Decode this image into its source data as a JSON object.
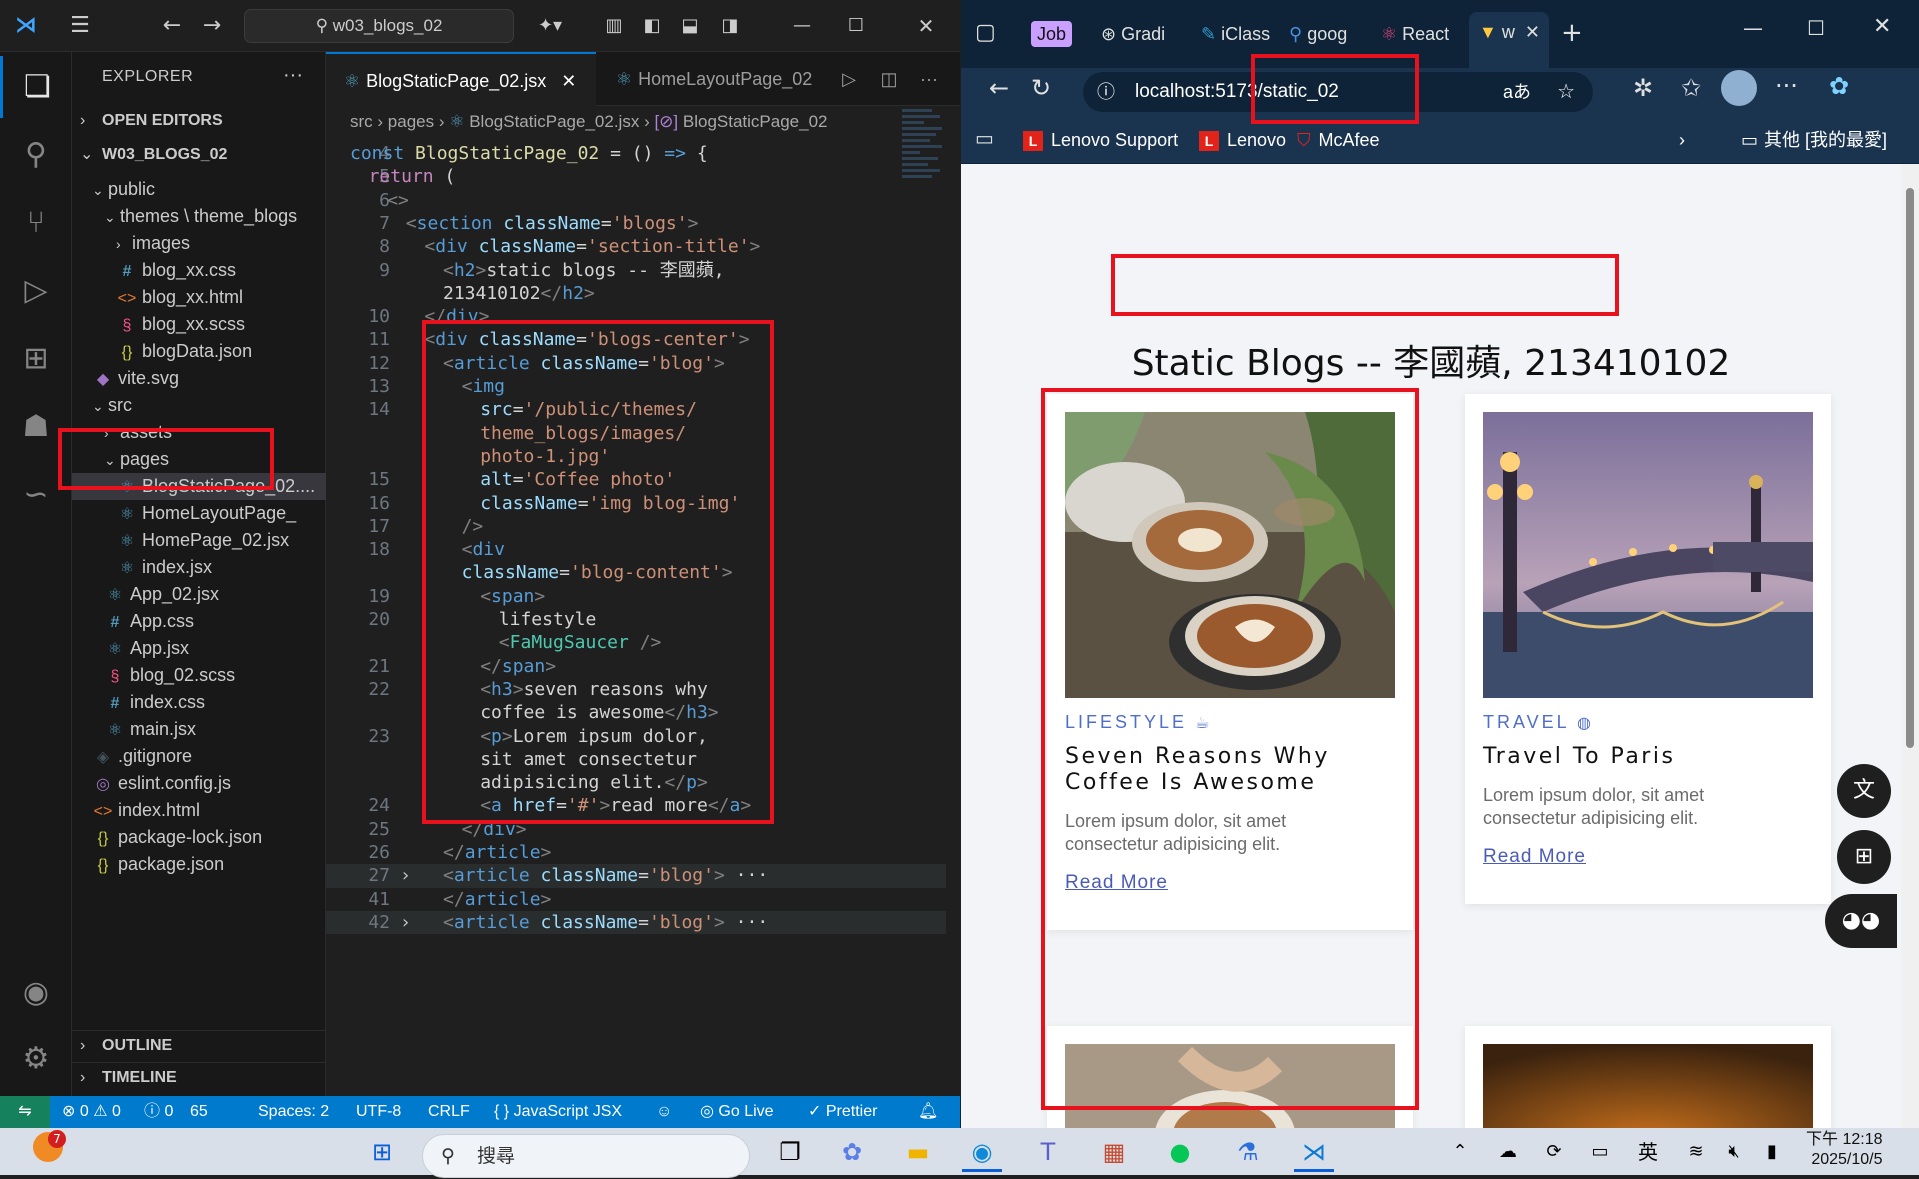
{
  "vscode": {
    "search": "w03_blogs_02",
    "explorer_title": "EXPLORER",
    "sections": {
      "open_editors": "OPEN EDITORS",
      "project": "W03_BLOGS_02",
      "outline": "OUTLINE",
      "timeline": "TIMELINE"
    },
    "tree": [
      {
        "label": "public",
        "icon": "chevron",
        "type": "folder"
      },
      {
        "label": "themes \\ theme_blogs",
        "icon": "chevron",
        "type": "folder"
      },
      {
        "label": "images",
        "icon": "chevron-right",
        "type": "folder"
      },
      {
        "label": "blog_xx.css",
        "icon": "#",
        "type": "css"
      },
      {
        "label": "blog_xx.html",
        "icon": "<>",
        "type": "html"
      },
      {
        "label": "blog_xx.scss",
        "icon": "scss",
        "type": "scss"
      },
      {
        "label": "blogData.json",
        "icon": "{}",
        "type": "json"
      },
      {
        "label": "vite.svg",
        "icon": "svg",
        "type": "svg"
      },
      {
        "label": "src",
        "icon": "chevron",
        "type": "folder"
      },
      {
        "label": "assets",
        "icon": "chevron-right",
        "type": "folder"
      },
      {
        "label": "pages",
        "icon": "chevron",
        "type": "folder"
      },
      {
        "label": "BlogStaticPage_02....",
        "icon": "react",
        "type": "react"
      },
      {
        "label": "HomeLayoutPage_",
        "icon": "react",
        "type": "react"
      },
      {
        "label": "HomePage_02.jsx",
        "icon": "react",
        "type": "react"
      },
      {
        "label": "index.jsx",
        "icon": "react",
        "type": "react"
      },
      {
        "label": "App_02.jsx",
        "icon": "react",
        "type": "react"
      },
      {
        "label": "App.css",
        "icon": "#",
        "type": "css"
      },
      {
        "label": "App.jsx",
        "icon": "react",
        "type": "react"
      },
      {
        "label": "blog_02.scss",
        "icon": "scss",
        "type": "scss"
      },
      {
        "label": "index.css",
        "icon": "#",
        "type": "css"
      },
      {
        "label": "main.jsx",
        "icon": "react",
        "type": "react"
      },
      {
        "label": ".gitignore",
        "icon": "git",
        "type": "git"
      },
      {
        "label": "eslint.config.js",
        "icon": "eslint",
        "type": "eslint"
      },
      {
        "label": "index.html",
        "icon": "<>",
        "type": "html"
      },
      {
        "label": "package-lock.json",
        "icon": "{}",
        "type": "json"
      },
      {
        "label": "package.json",
        "icon": "{}",
        "type": "json"
      }
    ],
    "tabs": [
      {
        "label": "BlogStaticPage_02.jsx",
        "active": true
      },
      {
        "label": "HomeLayoutPage_02",
        "active": false
      }
    ],
    "breadcrumb": [
      "src",
      "pages",
      "BlogStaticPage_02.jsx",
      "BlogStaticPage_02"
    ],
    "code_lines": [
      {
        "n": "4",
        "html": "<span class='kw'>const</span> <span class='fn'>BlogStaticPage_02</span> <span class='txt'>= () </span><span class='kw'>=&gt;</span><span class='txt'> {</span>",
        "indent": 0
      },
      {
        "n": "5",
        "html": "<span class='ctl'>return</span> <span class='txt'>(</span>",
        "indent": 1
      },
      {
        "n": "6",
        "html": "<span class='pu'>&lt;&gt;</span>",
        "indent": 2
      },
      {
        "n": "7",
        "html": "<span class='pu'>&lt;</span><span class='tg'>section</span> <span class='at'>className</span><span class='txt'>=</span><span class='st'>'blogs'</span><span class='pu'>&gt;</span>",
        "indent": 3
      },
      {
        "n": "8",
        "html": "<span class='pu'>&lt;</span><span class='tg'>div</span> <span class='at'>className</span><span class='txt'>=</span><span class='st'>'section-title'</span><span class='pu'>&gt;</span>",
        "indent": 4
      },
      {
        "n": "9",
        "html": "<span class='pu'>&lt;</span><span class='tg'>h2</span><span class='pu'>&gt;</span><span class='txt'>static blogs -- 李國蘋,</span>",
        "indent": 5
      },
      {
        "n": "",
        "html": "<span class='txt'>213410102</span><span class='pu'>&lt;/</span><span class='tg'>h2</span><span class='pu'>&gt;</span>",
        "indent": 5
      },
      {
        "n": "10",
        "html": "<span class='pu'>&lt;/</span><span class='tg'>div</span><span class='pu'>&gt;</span>",
        "indent": 4
      },
      {
        "n": "11",
        "html": "<span class='pu'>&lt;</span><span class='tg'>div</span> <span class='at'>className</span><span class='txt'>=</span><span class='st'>'blogs-center'</span><span class='pu'>&gt;</span>",
        "indent": 4
      },
      {
        "n": "12",
        "html": "<span class='pu'>&lt;</span><span class='tg'>article</span> <span class='at'>className</span><span class='txt'>=</span><span class='st'>'blog'</span><span class='pu'>&gt;</span>",
        "indent": 5
      },
      {
        "n": "13",
        "html": "<span class='pu'>&lt;</span><span class='tg'>img</span>",
        "indent": 6
      },
      {
        "n": "14",
        "html": "<span class='at'>src</span><span class='txt'>=</span><span class='st'>'/public/themes/</span>",
        "indent": 7
      },
      {
        "n": "",
        "html": "<span class='st'>theme_blogs/images/</span>",
        "indent": 7
      },
      {
        "n": "",
        "html": "<span class='st'>photo-1.jpg'</span>",
        "indent": 7
      },
      {
        "n": "15",
        "html": "<span class='at'>alt</span><span class='txt'>=</span><span class='st'>'Coffee photo'</span>",
        "indent": 7
      },
      {
        "n": "16",
        "html": "<span class='at'>className</span><span class='txt'>=</span><span class='st'>'img blog-img'</span>",
        "indent": 7
      },
      {
        "n": "17",
        "html": "<span class='pu'>/&gt;</span>",
        "indent": 6
      },
      {
        "n": "18",
        "html": "<span class='pu'>&lt;</span><span class='tg'>div</span>",
        "indent": 6
      },
      {
        "n": "",
        "html": "<span class='at'>className</span><span class='txt'>=</span><span class='st'>'blog-content'</span><span class='pu'>&gt;</span>",
        "indent": 6
      },
      {
        "n": "19",
        "html": "<span class='pu'>&lt;</span><span class='tg'>span</span><span class='pu'>&gt;</span>",
        "indent": 7
      },
      {
        "n": "20",
        "html": "<span class='txt'>lifestyle</span>",
        "indent": 8
      },
      {
        "n": "",
        "html": "<span class='pu'>&lt;</span><span class='cmp'>FaMugSaucer</span> <span class='pu'>/&gt;</span>",
        "indent": 8
      },
      {
        "n": "21",
        "html": "<span class='pu'>&lt;/</span><span class='tg'>span</span><span class='pu'>&gt;</span>",
        "indent": 7
      },
      {
        "n": "22",
        "html": "<span class='pu'>&lt;</span><span class='tg'>h3</span><span class='pu'>&gt;</span><span class='txt'>seven reasons why</span>",
        "indent": 7
      },
      {
        "n": "",
        "html": "<span class='txt'>coffee is awesome</span><span class='pu'>&lt;/</span><span class='tg'>h3</span><span class='pu'>&gt;</span>",
        "indent": 7
      },
      {
        "n": "23",
        "html": "<span class='pu'>&lt;</span><span class='tg'>p</span><span class='pu'>&gt;</span><span class='txt'>Lorem ipsum dolor,</span>",
        "indent": 7
      },
      {
        "n": "",
        "html": "<span class='txt'>sit amet consectetur</span>",
        "indent": 7
      },
      {
        "n": "",
        "html": "<span class='txt'>adipisicing elit.</span><span class='pu'>&lt;/</span><span class='tg'>p</span><span class='pu'>&gt;</span>",
        "indent": 7
      },
      {
        "n": "24",
        "html": "<span class='pu'>&lt;</span><span class='tg'>a</span> <span class='at'>href</span><span class='txt'>=</span><span class='st'>'#'</span><span class='pu'>&gt;</span><span class='txt'>read more</span><span class='pu'>&lt;/</span><span class='tg'>a</span><span class='pu'>&gt;</span>",
        "indent": 7
      },
      {
        "n": "25",
        "html": "<span class='pu'>&lt;/</span><span class='tg'>div</span><span class='pu'>&gt;</span>",
        "indent": 6
      },
      {
        "n": "26",
        "html": "<span class='pu'>&lt;/</span><span class='tg'>article</span><span class='pu'>&gt;</span>",
        "indent": 5
      },
      {
        "n": "27",
        "html": "<span class='pu'>&lt;</span><span class='tg'>article</span> <span class='at'>className</span><span class='txt'>=</span><span class='st'>'blog'</span><span class='pu'>&gt;</span><span class='txt'> ···</span>",
        "indent": 5
      },
      {
        "n": "41",
        "html": "<span class='pu'>&lt;/</span><span class='tg'>article</span><span class='pu'>&gt;</span>",
        "indent": 5
      },
      {
        "n": "42",
        "html": "<span class='pu'>&lt;</span><span class='tg'>article</span> <span class='at'>className</span><span class='txt'>=</span><span class='st'>'blog'</span><span class='pu'>&gt;</span><span class='txt'> ···</span>",
        "indent": 5
      }
    ],
    "status": {
      "problems": "⊗ 0 ⚠ 0",
      "info": "ⓘ 0",
      "ports": "65",
      "spaces": "Spaces: 2",
      "encoding": "UTF-8",
      "eol": "CRLF",
      "language": "{ } JavaScript JSX",
      "golive": "Go Live",
      "prettier": "✓ Prettier"
    }
  },
  "browser": {
    "tabs": [
      "Job",
      "Gradi",
      "iClass",
      "goog",
      "React",
      "w"
    ],
    "url": "localhost:5173/static_02",
    "bookmarks": [
      "Lenovo Support",
      "Lenovo",
      "McAfee"
    ],
    "bookmarks_folder": "其他 [我的最愛]",
    "read_aloud": "aあ",
    "page_title": "Static Blogs -- 李國蘋, 213410102",
    "cards": [
      {
        "category": "LIFESTYLE",
        "category_icon": "mug-icon",
        "title_line1": "Seven Reasons Why",
        "title_line2": "Coffee Is Awesome",
        "desc_line1": "Lorem ipsum dolor, sit amet",
        "desc_line2": "consectetur adipisicing elit.",
        "more": "Read More"
      },
      {
        "category": "TRAVEL",
        "category_icon": "globe-icon",
        "title_line1": "Travel To Paris",
        "title_line2": "",
        "desc_line1": "Lorem ipsum dolor, sit amet",
        "desc_line2": "consectetur adipisicing elit.",
        "more": "Read More"
      }
    ]
  },
  "taskbar": {
    "search": "搜尋",
    "notification_count": "7",
    "ime": "英",
    "time": "下午 12:18",
    "date": "2025/10/5"
  }
}
